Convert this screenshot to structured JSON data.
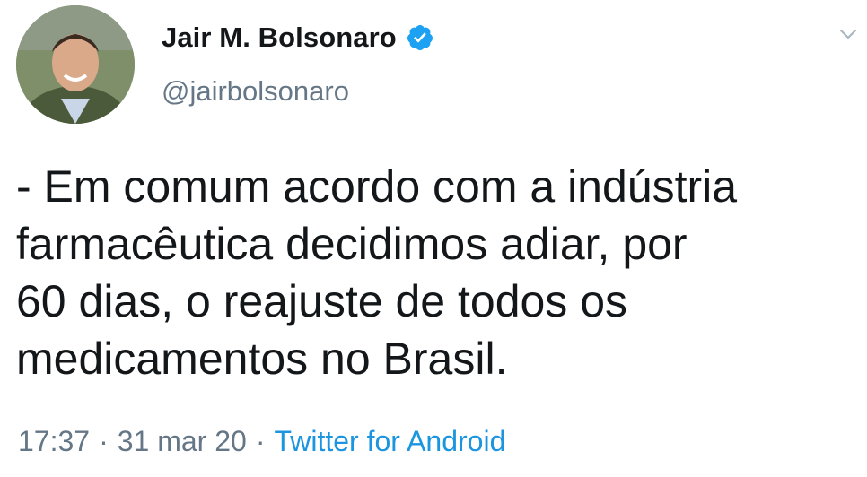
{
  "author": {
    "display_name": "Jair M. Bolsonaro",
    "handle": "@jairbolsonaro",
    "verified": true
  },
  "tweet": {
    "text": "- Em comum acordo com a indústria\nfarmacêutica decidimos adiar, por\n60 dias, o reajuste de todos os\nmedicamentos no Brasil."
  },
  "meta": {
    "time": "17:37",
    "separator": "·",
    "date": "31 mar 20",
    "source": "Twitter for Android"
  },
  "colors": {
    "text": "#14171a",
    "secondary": "#657786",
    "link": "#1b95e0",
    "verified": "#1da1f2"
  }
}
